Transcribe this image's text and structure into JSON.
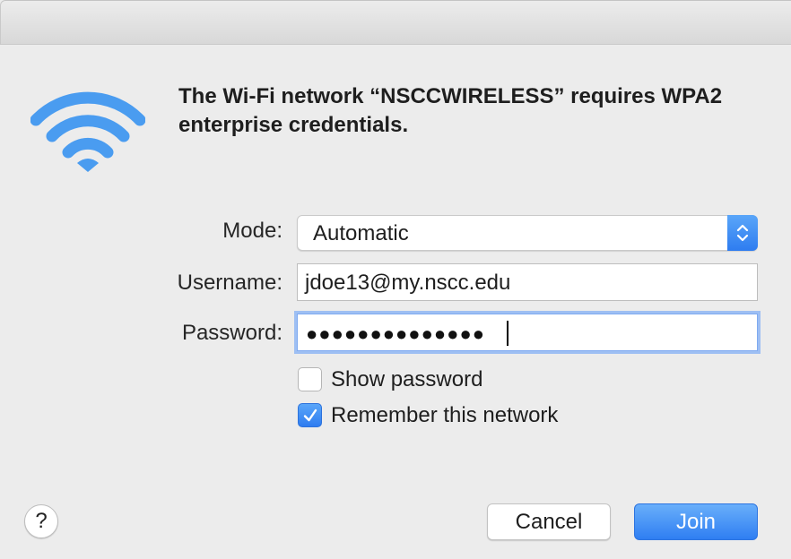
{
  "dialog": {
    "message": "The Wi-Fi network “NSCCWIRELESS” requires WPA2 enterprise credentials.",
    "icon": "wifi-icon"
  },
  "form": {
    "mode_label": "Mode:",
    "mode_value": "Automatic",
    "username_label": "Username:",
    "username_value": "jdoe13@my.nscc.edu",
    "password_label": "Password:",
    "password_mask": "●●●●●●●●●●●●●●",
    "show_password_label": "Show password",
    "show_password_checked": false,
    "remember_label": "Remember this network",
    "remember_checked": true
  },
  "buttons": {
    "help": "?",
    "cancel": "Cancel",
    "join": "Join"
  },
  "colors": {
    "accent": "#2f7ef2",
    "wifi_icon": "#4a9cf0"
  }
}
